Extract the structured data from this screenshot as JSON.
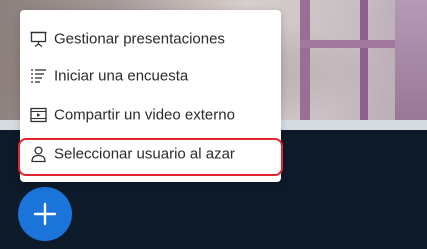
{
  "menu": {
    "items": [
      {
        "label": "Gestionar presentaciones",
        "icon": "presentation-icon"
      },
      {
        "label": "Iniciar una encuesta",
        "icon": "poll-list-icon"
      },
      {
        "label": "Compartir un video externo",
        "icon": "video-icon"
      },
      {
        "label": "Seleccionar usuario al azar",
        "icon": "user-icon",
        "highlighted": true
      }
    ]
  },
  "fab": {
    "icon": "plus-icon",
    "color": "#1b74d9"
  },
  "colors": {
    "bottom_bar": "#0c1a2a",
    "highlight_ring": "#e0262a",
    "menu_text": "#2b2b2b"
  }
}
